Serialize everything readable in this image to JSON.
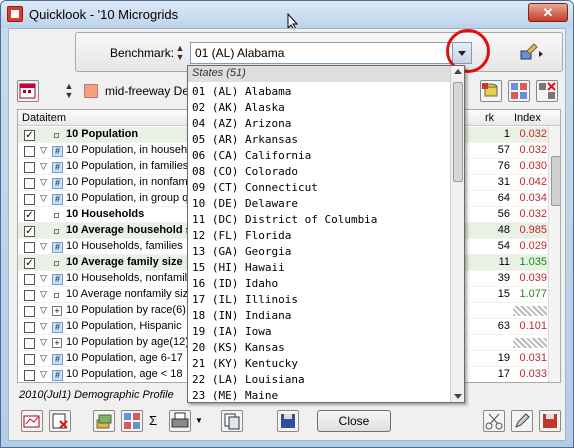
{
  "window": {
    "title": "Quicklook - '10 Microgrids",
    "close_glyph": "✕"
  },
  "benchmark": {
    "label": "Benchmark:",
    "selected": "01 (AL) Alabama"
  },
  "trade_area": {
    "name": "mid-freeway Des M"
  },
  "table": {
    "headers": {
      "dataitem": "Dataitem",
      "mark": "rk",
      "index": "Index"
    },
    "rows": [
      {
        "checked": true,
        "kind": "sq",
        "label": "10 Population",
        "bold": true,
        "mark": "1",
        "index": "0.032"
      },
      {
        "checked": false,
        "kind": "hash",
        "label": "10 Population, in househo",
        "mark": "57",
        "index": "0.032"
      },
      {
        "checked": false,
        "kind": "hash",
        "label": "10 Population, in families",
        "mark": "76",
        "index": "0.030"
      },
      {
        "checked": false,
        "kind": "hash",
        "label": "10 Population, in nonfam",
        "mark": "31",
        "index": "0.042"
      },
      {
        "checked": false,
        "kind": "hash",
        "label": "10 Population, in group q",
        "mark": "64",
        "index": "0.034"
      },
      {
        "checked": true,
        "kind": "sq",
        "label": "10 Households",
        "bold": true,
        "mark": "56",
        "index": "0.032"
      },
      {
        "checked": true,
        "kind": "sq",
        "label": "10 Average household s",
        "bold": true,
        "mark": "48",
        "index": "0.985"
      },
      {
        "checked": false,
        "kind": "hash",
        "label": "10 Households, families",
        "mark": "54",
        "index": "0.029"
      },
      {
        "checked": true,
        "kind": "sq",
        "label": "10 Average family size",
        "bold": true,
        "mark": "11",
        "index": "1.035"
      },
      {
        "checked": false,
        "kind": "hash",
        "label": "10 Households, nonfamil",
        "mark": "39",
        "index": "0.039"
      },
      {
        "checked": false,
        "kind": "sq",
        "label": "10 Average nonfamily size",
        "mark": "15",
        "index": "1.077"
      },
      {
        "checked": false,
        "kind": "plus",
        "label": "10 Population by race(6)",
        "mark": "",
        "index": "hatch"
      },
      {
        "checked": false,
        "kind": "hash",
        "label": "10 Population, Hispanic",
        "mark": "63",
        "index": "0.101"
      },
      {
        "checked": false,
        "kind": "plus",
        "label": "10 Population by age(12)",
        "mark": "",
        "index": "hatch"
      },
      {
        "checked": false,
        "kind": "hash",
        "label": "10 Population, age 6-17",
        "mark": "19",
        "index": "0.031"
      },
      {
        "checked": false,
        "kind": "hash",
        "label": "10 Population, age < 18",
        "mark": "17",
        "index": "0.033"
      }
    ]
  },
  "status": "2010(Jul1) Demographic Profile",
  "buttons": {
    "close": "Close",
    "sigma": "Σ"
  },
  "dropdown": {
    "header": "States (51)",
    "items": [
      "01 (AL) Alabama",
      "02 (AK) Alaska",
      "04 (AZ) Arizona",
      "05 (AR) Arkansas",
      "06 (CA) California",
      "08 (CO) Colorado",
      "09 (CT) Connecticut",
      "10 (DE) Delaware",
      "11 (DC) District of Columbia",
      "12 (FL) Florida",
      "13 (GA) Georgia",
      "15 (HI) Hawaii",
      "16 (ID) Idaho",
      "17 (IL) Illinois",
      "18 (IN) Indiana",
      "19 (IA) Iowa",
      "20 (KS) Kansas",
      "21 (KY) Kentucky",
      "22 (LA) Louisiana",
      "23 (ME) Maine"
    ]
  }
}
